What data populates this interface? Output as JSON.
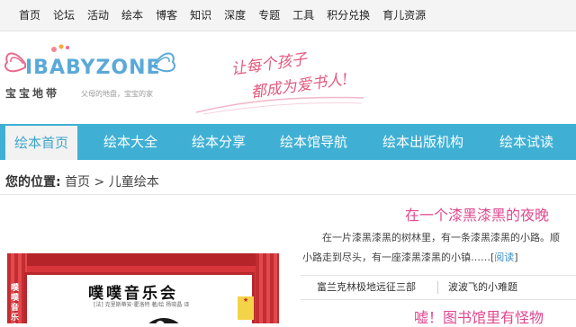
{
  "top_nav": [
    "首页",
    "论坛",
    "活动",
    "绘本",
    "博客",
    "知识",
    "深度",
    "专题",
    "工具",
    "积分兑换",
    "育儿资源"
  ],
  "logo": {
    "main": "IBABYZONE",
    "cn": "宝宝地带",
    "sub": "父母的地盘，宝宝的家"
  },
  "slogan": {
    "line1": "让每个孩子",
    "line2": "都成为爱书人!"
  },
  "main_nav": [
    "绘本首页",
    "绘本大全",
    "绘本分享",
    "绘本馆导航",
    "绘本出版机构",
    "绘本试读"
  ],
  "breadcrumb": {
    "label": "您的位置:",
    "home": "首页",
    "sep": ">",
    "current": "儿童绘本"
  },
  "cover": {
    "title": "噗噗音乐会",
    "author": "[法] 克里斯蒂安·霍洛特 著/绘   杨晓晶 译",
    "side": "噗噗音乐会"
  },
  "article1": {
    "title": "在一个漆黑漆黑的夜晚",
    "para1": "在一片漆黑漆黑的树林里，有一条漆黑漆黑的小路。顺",
    "para2": "小路走到尽头，有一座漆黑漆黑的小镇……[",
    "readmore": "阅读",
    "close": "]",
    "related": [
      "富兰克林极地远征三部",
      "波波飞的小难题"
    ]
  },
  "article2": {
    "title": "嘘！图书馆里有怪物"
  },
  "colors": {
    "nav_blue": "#3fb0d4",
    "title_pink": "#e0488f",
    "link_blue": "#3a8fc5"
  }
}
